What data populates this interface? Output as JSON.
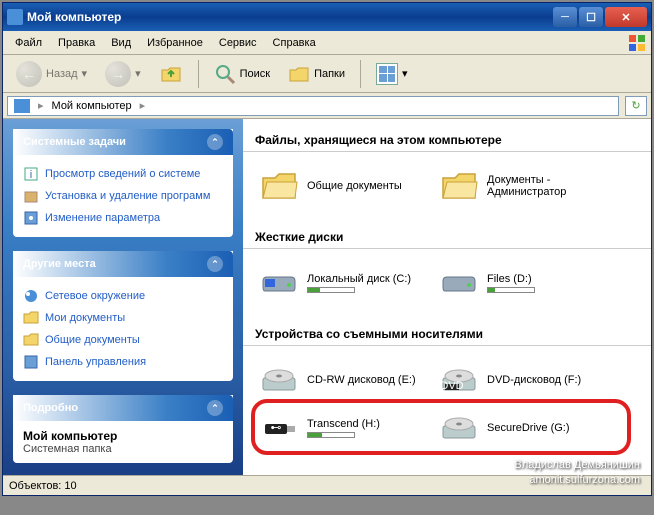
{
  "titlebar": {
    "title": "Мой компьютер"
  },
  "menu": {
    "file": "Файл",
    "edit": "Правка",
    "view": "Вид",
    "favorites": "Избранное",
    "service": "Сервис",
    "help": "Справка"
  },
  "toolbar": {
    "back": "Назад",
    "search": "Поиск",
    "folders": "Папки"
  },
  "address": {
    "path": "Мой компьютер"
  },
  "sidebar": {
    "tasks": {
      "title": "Системные задачи",
      "items": [
        {
          "label": "Просмотр сведений о системе"
        },
        {
          "label": "Установка и удаление программ"
        },
        {
          "label": "Изменение параметра"
        }
      ]
    },
    "places": {
      "title": "Другие места",
      "items": [
        {
          "label": "Сетевое окружение"
        },
        {
          "label": "Мои документы"
        },
        {
          "label": "Общие документы"
        },
        {
          "label": "Панель управления"
        }
      ]
    },
    "details": {
      "title": "Подробно",
      "name": "Мой компьютер",
      "type": "Системная папка"
    }
  },
  "content": {
    "sec_files": "Файлы, хранящиеся на этом компьютере",
    "sec_drives": "Жесткие диски",
    "sec_removable": "Устройства со съемными носителями",
    "files": [
      {
        "label": "Общие документы"
      },
      {
        "label": "Документы - Администратор"
      }
    ],
    "drives": [
      {
        "label": "Локальный диск (C:)",
        "fill": 25
      },
      {
        "label": "Files (D:)",
        "fill": 15
      }
    ],
    "removable": [
      {
        "label": "CD-RW дисковод (E:)"
      },
      {
        "label": "DVD-дисковод (F:)"
      },
      {
        "label": "Transcend (H:)",
        "fill": 30
      },
      {
        "label": "SecureDrive (G:)"
      }
    ]
  },
  "statusbar": {
    "objects": "Объектов: 10"
  },
  "watermark": {
    "author": "Владислав Демьянишин",
    "site": "amonit.sulfurzona.com"
  }
}
